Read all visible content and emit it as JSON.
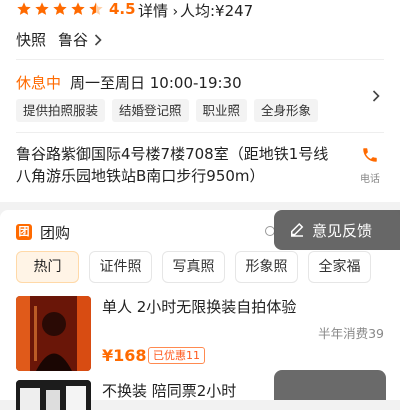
{
  "rating": {
    "stars": 4.5,
    "score": "4.5",
    "details_label": "详情",
    "avg_price": "人均:¥247"
  },
  "category": {
    "sub": "快照",
    "area": "鲁谷"
  },
  "hours": {
    "status": "休息中",
    "schedule": "周一至周日 10:00-19:30"
  },
  "tags": [
    "提供拍照服装",
    "结婚登记照",
    "职业照",
    "全身形象"
  ],
  "address": {
    "text": "鲁谷路紫御国际4号楼7楼708室（距地铁1号线八角游乐园地铁站B南口步行950m）",
    "phone_label": "电话"
  },
  "group": {
    "icon_label": "团",
    "title": "团购",
    "feedback_label": "意见反馈"
  },
  "filters": [
    "热门",
    "证件照",
    "写真照",
    "形象照",
    "全家福"
  ],
  "deals": [
    {
      "title": "单人 2小时无限换装自拍体验",
      "sold": "半年消费39",
      "price": "¥168",
      "promo": "已优惠11"
    },
    {
      "title": "不换装 陪同票2小时"
    }
  ],
  "colors": {
    "accent": "#ff6a00",
    "bg": "#f2f2f2"
  }
}
